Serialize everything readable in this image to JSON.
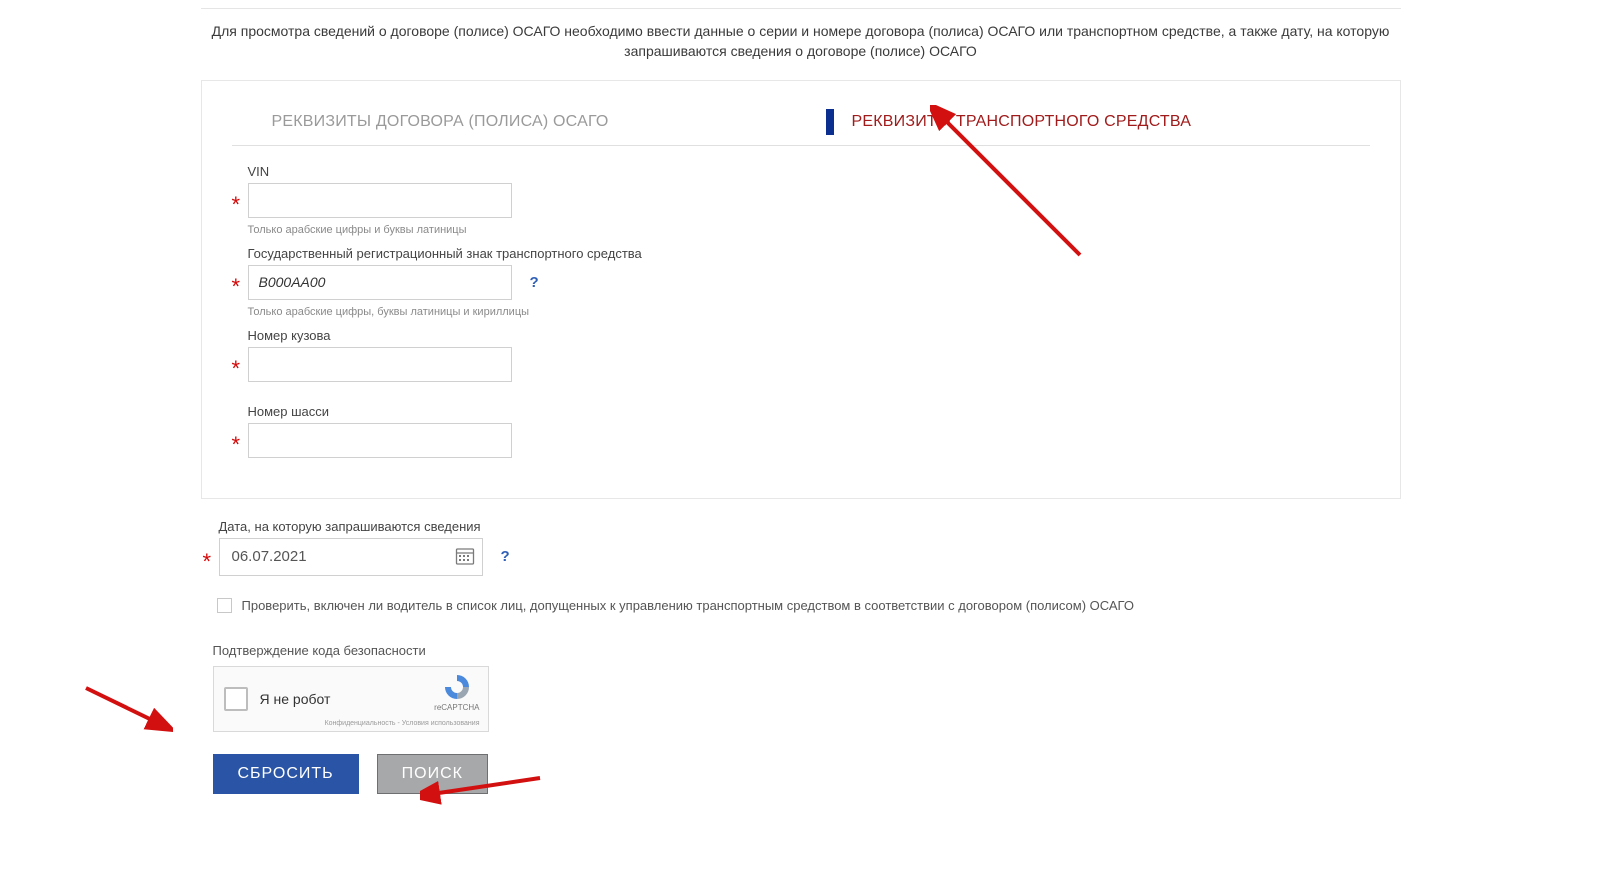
{
  "intro": "Для просмотра сведений о договоре (полисе) ОСАГО необходимо ввести данные о серии и номере договора (полиса) ОСАГО или транспортном средстве, а также дату, на которую запрашиваются сведения о договоре (полисе) ОСАГО",
  "tabs": {
    "policy": "РЕКВИЗИТЫ ДОГОВОРА (ПОЛИСА) ОСАГО",
    "vehicle": "РЕКВИЗИТЫ ТРАНСПОРТНОГО СРЕДСТВА"
  },
  "fields": {
    "vin": {
      "label": "VIN",
      "value": "",
      "hint": "Только арабские цифры и буквы латиницы"
    },
    "plate": {
      "label": "Государственный регистрационный знак транспортного средства",
      "value": "В000АА00",
      "hint": "Только арабские цифры, буквы латиницы и кириллицы"
    },
    "body": {
      "label": "Номер кузова",
      "value": ""
    },
    "chassis": {
      "label": "Номер шасси",
      "value": ""
    },
    "date": {
      "label": "Дата, на которую запрашиваются сведения",
      "value": "06.07.2021"
    }
  },
  "help_symbol": "?",
  "required_symbol": "*",
  "driver_check": "Проверить, включен ли водитель в список лиц, допущенных к управлению транспортным средством в соответствии с договором (полисом) ОСАГО",
  "captcha": {
    "title": "Подтверждение кода безопасности",
    "label": "Я не робот",
    "brand": "reCAPTCHA",
    "terms": "Конфиденциальность - Условия использования"
  },
  "buttons": {
    "reset": "СБРОСИТЬ",
    "search": "ПОИСК"
  }
}
